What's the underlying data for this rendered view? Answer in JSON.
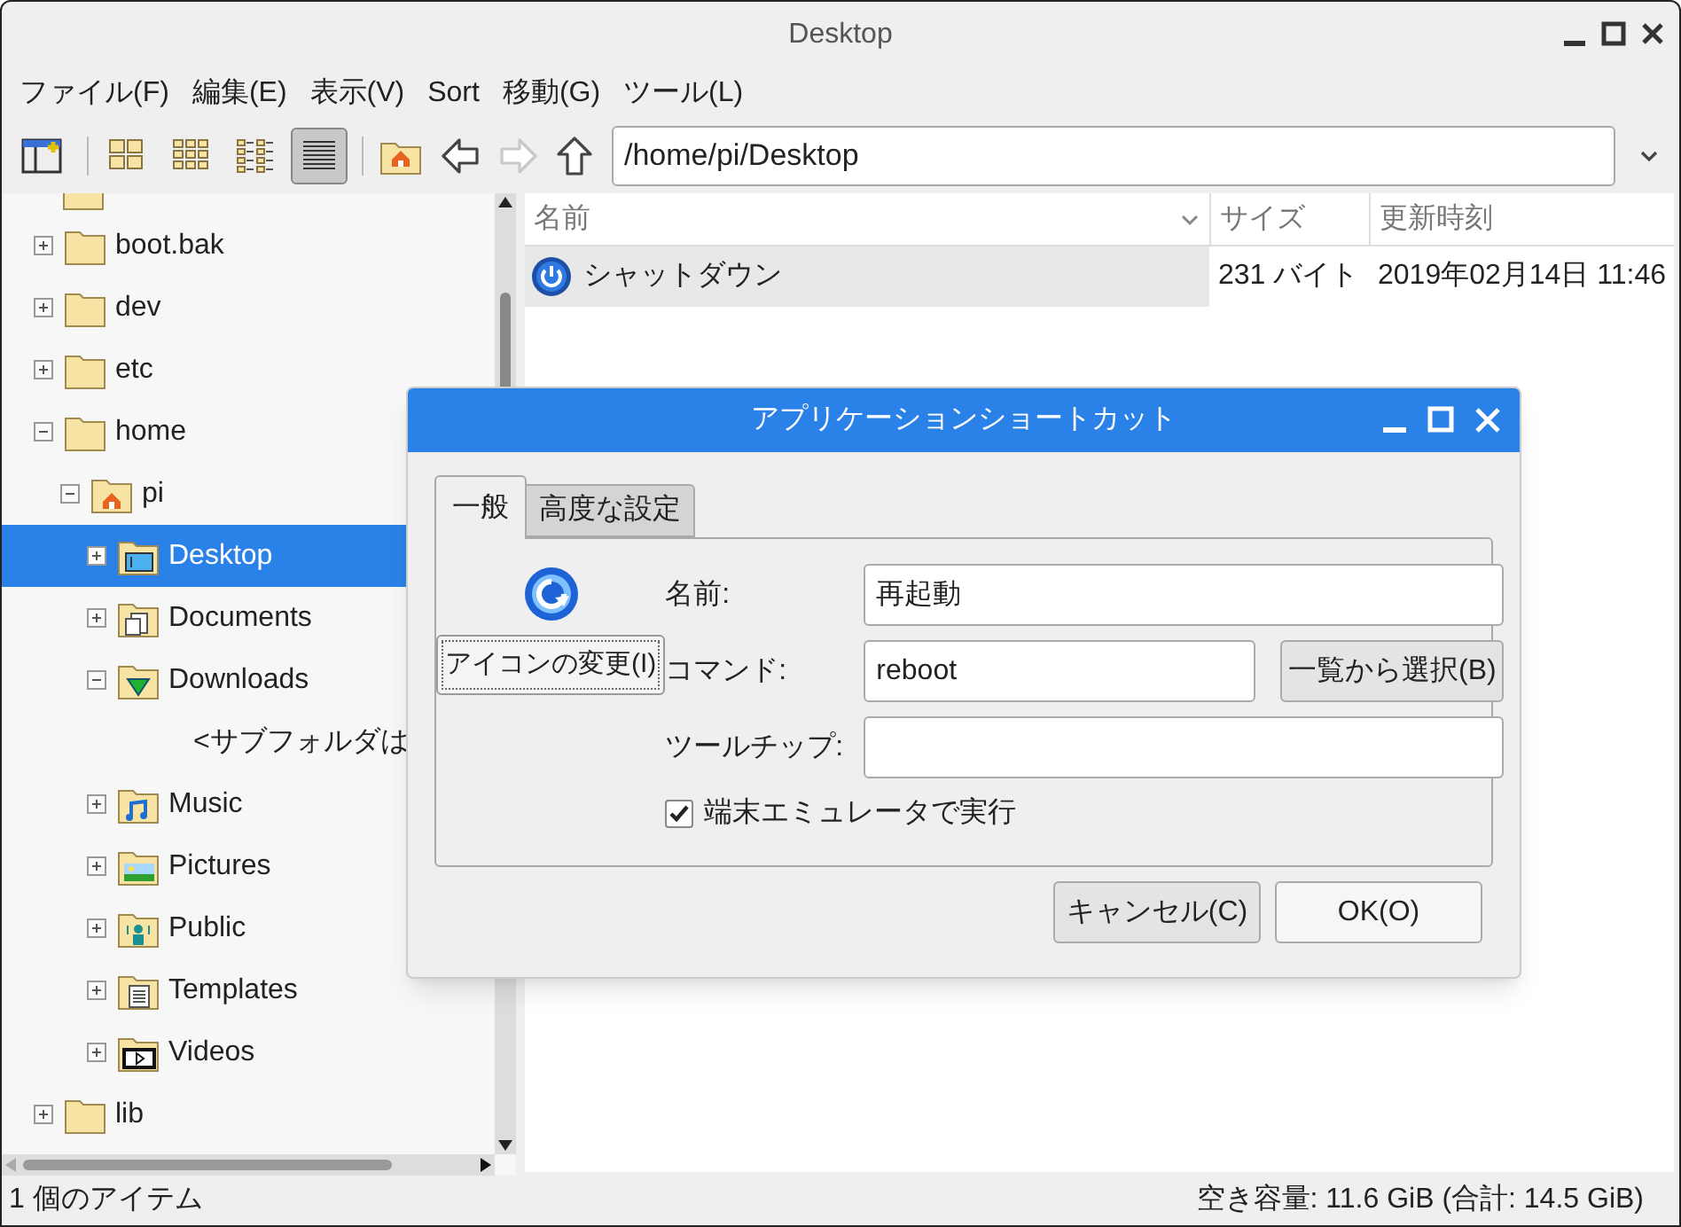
{
  "window": {
    "title": "Desktop"
  },
  "menu": [
    "ファイル(F)",
    "編集(E)",
    "表示(V)",
    "Sort",
    "移動(G)",
    "ツール(L)"
  ],
  "toolbar": {
    "view_modes": [
      {
        "kind": "icons",
        "selected": false
      },
      {
        "kind": "thumbnails",
        "selected": false
      },
      {
        "kind": "compact",
        "selected": false
      },
      {
        "kind": "list",
        "selected": true
      }
    ],
    "nav": [
      {
        "kind": "back",
        "disabled": false
      },
      {
        "kind": "forward",
        "disabled": true
      },
      {
        "kind": "up",
        "disabled": false
      }
    ]
  },
  "location": {
    "value": "/home/pi/Desktop"
  },
  "tree": [
    {
      "label": "boot.bak",
      "kind": "folder",
      "expanded": false,
      "selected": false
    },
    {
      "label": "dev",
      "kind": "folder",
      "expanded": false,
      "selected": false
    },
    {
      "label": "etc",
      "kind": "folder",
      "expanded": false,
      "selected": false
    },
    {
      "label": "home",
      "kind": "folder",
      "expanded": true,
      "selected": false,
      "children": [
        {
          "label": "pi",
          "kind": "home",
          "expanded": true,
          "selected": false,
          "children": [
            {
              "label": "Desktop",
              "kind": "desktop",
              "expanded": false,
              "selected": true
            },
            {
              "label": "Documents",
              "kind": "documents",
              "expanded": false,
              "selected": false
            },
            {
              "label": "Downloads",
              "kind": "downloads",
              "expanded": true,
              "selected": false,
              "children": [
                {
                  "label": "<サブフォルダは",
                  "kind": "placeholder"
                }
              ]
            },
            {
              "label": "Music",
              "kind": "music",
              "expanded": false,
              "selected": false
            },
            {
              "label": "Pictures",
              "kind": "pictures",
              "expanded": false,
              "selected": false
            },
            {
              "label": "Public",
              "kind": "public",
              "expanded": false,
              "selected": false
            },
            {
              "label": "Templates",
              "kind": "templates",
              "expanded": false,
              "selected": false
            },
            {
              "label": "Videos",
              "kind": "videos",
              "expanded": false,
              "selected": false
            }
          ]
        }
      ]
    },
    {
      "label": "lib",
      "kind": "folder",
      "expanded": false,
      "selected": false
    }
  ],
  "file_list": {
    "columns": [
      "名前",
      "サイズ",
      "更新時刻"
    ],
    "rows": [
      {
        "name": "シャットダウン",
        "size": "231 バイト",
        "modified": "2019年02月14日 11:46",
        "selected": true
      }
    ]
  },
  "status_bar": {
    "left": "1 個のアイテム",
    "right": "空き容量: 11.6 GiB (合計: 14.5 GiB)"
  },
  "dialog": {
    "title": "アプリケーションショートカット",
    "tabs": [
      {
        "label": "一般",
        "selected": true
      },
      {
        "label": "高度な設定",
        "selected": false
      }
    ],
    "change_icon_button": "アイコンの変更(I)",
    "fields": [
      {
        "label": "名前:",
        "value": "再起動"
      },
      {
        "label": "コマンド:",
        "value": "reboot",
        "button": "一覧から選択(B)"
      },
      {
        "label": "ツールチップ:"
      }
    ],
    "checkbox": {
      "label": "端末エミュレータで実行",
      "checked": true
    },
    "buttons": [
      "キャンセル(C)",
      "OK(O)"
    ]
  }
}
